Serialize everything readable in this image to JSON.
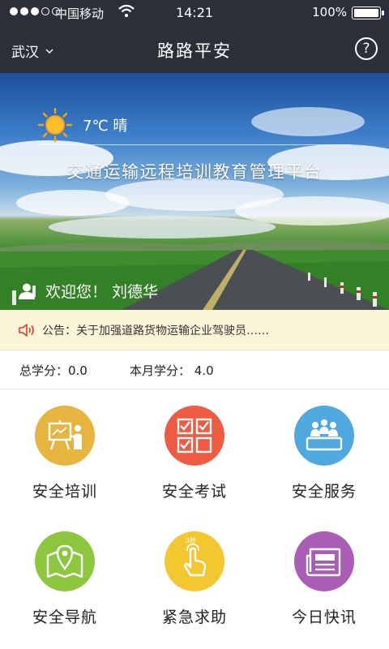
{
  "status_bar": {
    "carrier": "中国移动",
    "time": "14:21",
    "battery": "100%"
  },
  "nav": {
    "city": "武汉",
    "title": "路路平安",
    "help_label": "?"
  },
  "banner": {
    "weather": "7℃ 晴",
    "platform_title": "交通运输远程培训教育管理平台",
    "welcome": "欢迎您！ 刘德华"
  },
  "notice": {
    "text": "公告：关于加强道路货物运输企业驾驶员……"
  },
  "scores": {
    "total": "总学分：0.0",
    "month": "本月学分： 4.0"
  },
  "menu": [
    {
      "label": "安全培训",
      "icon": "training-board-icon",
      "color": "#e7b43f"
    },
    {
      "label": "安全考试",
      "icon": "exam-checklist-icon",
      "color": "#ef5a42"
    },
    {
      "label": "安全服务",
      "icon": "service-group-icon",
      "color": "#4fa9e0"
    },
    {
      "label": "安全导航",
      "icon": "map-navigation-icon",
      "color": "#8dc63f"
    },
    {
      "label": "紧急求助",
      "icon": "emergency-press-icon",
      "color": "#f3c72f"
    },
    {
      "label": "今日快讯",
      "icon": "news-paper-icon",
      "color": "#a95db7"
    }
  ],
  "emergency_badge": "3秒"
}
